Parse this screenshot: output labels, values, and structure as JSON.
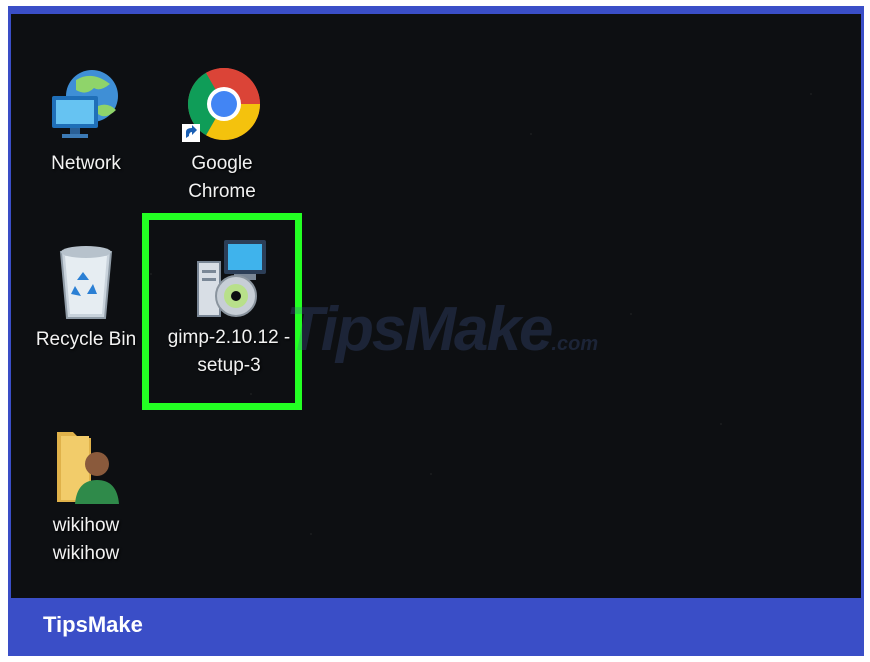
{
  "desktop": {
    "icons": [
      {
        "label": "Network",
        "icon": "network-icon"
      },
      {
        "label": "Google Chrome",
        "icon": "chrome-icon"
      },
      {
        "label": "Recycle Bin",
        "icon": "recycle-bin-icon"
      },
      {
        "label": "gimp-2.10.12 -setup-3",
        "icon": "installer-icon"
      },
      {
        "label": "wikihow wikihow",
        "icon": "user-folder-icon"
      }
    ],
    "highlight_color": "#23ff23"
  },
  "watermark": {
    "text": "TipsMake",
    "suffix": ".com"
  },
  "footer": {
    "brand": "TipsMake"
  },
  "colors": {
    "frame": "#3a4ec7",
    "desktop_bg": "#0d0f12"
  }
}
